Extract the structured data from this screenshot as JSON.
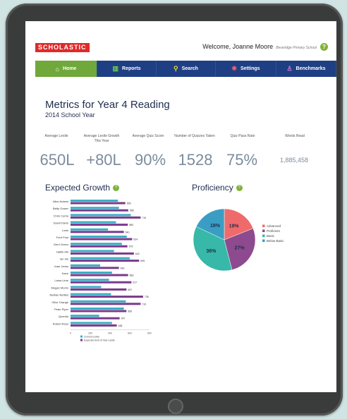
{
  "header": {
    "logo_text": "SCHOLASTIC",
    "welcome": "Welcome, Joanne Moore",
    "school": "Beveridge Primary School",
    "help_icon": "?"
  },
  "nav": {
    "tabs": [
      {
        "label": "Home",
        "icon": "home-icon",
        "active": true
      },
      {
        "label": "Reports",
        "icon": "bar-chart-icon",
        "active": false
      },
      {
        "label": "Search",
        "icon": "search-icon",
        "active": false
      },
      {
        "label": "Settings",
        "icon": "gear-icon",
        "active": false
      },
      {
        "label": "Benchmarks",
        "icon": "person-icon",
        "active": false
      }
    ]
  },
  "page": {
    "title": "Metrics for Year 4 Reading",
    "subtitle": "2014 School Year"
  },
  "metrics": [
    {
      "label": "Average Lexile",
      "value": "650L"
    },
    {
      "label": "Average Lexile Growth This Year",
      "value": "+80L"
    },
    {
      "label": "Average Quiz Score",
      "value": "90%"
    },
    {
      "label": "Number of Quizzes Taken",
      "value": "1528"
    },
    {
      "label": "Quiz Pass Rate",
      "value": "75%"
    },
    {
      "label": "Words Read",
      "value": "1,885,458"
    }
  ],
  "expected_growth": {
    "title": "Expected Growth",
    "info": "?"
  },
  "proficiency": {
    "title": "Proficiency",
    "info": "?"
  },
  "chart_data": [
    {
      "type": "bar",
      "orientation": "horizontal",
      "categories": [
        "Alice Adams",
        "Betty Gower",
        "Chris Currie",
        "David Davis",
        "Leah",
        "Fred Post",
        "Gerri Green",
        "Hattie Hill",
        "Ian Ink",
        "Joan Jones",
        "Kane",
        "Laina Lime",
        "Megan Morris",
        "Nathan Nettles",
        "Olive Orange",
        "Peter Piper",
        "Quentin",
        "Robert Ross"
      ],
      "series": [
        {
          "name": "Current Lexile",
          "color": "#3aaec4",
          "values": [
            480,
            490,
            610,
            460,
            380,
            570,
            520,
            440,
            600,
            300,
            420,
            390,
            310,
            410,
            560,
            540,
            290,
            420
          ]
        },
        {
          "name": "Expected End of Year Lexile",
          "color": "#7a3a8c",
          "values": [
            555,
            585,
            710,
            580,
            540,
            624,
            576,
            642,
            695,
            490,
            583,
            617,
            567,
            735,
            710,
            566,
            497,
            468
          ]
        }
      ],
      "data_labels": [
        "555",
        "585",
        "710",
        "580",
        "540",
        "624",
        "576",
        "642",
        "695",
        "490",
        "583",
        "617",
        "567",
        "735",
        "710",
        "566",
        "497",
        "468"
      ],
      "xlim": [
        0,
        800
      ],
      "xticks": [
        "0",
        "200",
        "400",
        "600",
        "800"
      ]
    },
    {
      "type": "pie",
      "labels": [
        "Advanced",
        "Proficient",
        "Basic",
        "Below Basic"
      ],
      "values": [
        19,
        27,
        36,
        18
      ],
      "colors": [
        "#ef6b6b",
        "#8e4a8e",
        "#37b8a8",
        "#3a9ec4"
      ],
      "value_labels": [
        "19%",
        "27%",
        "36%",
        "18%"
      ]
    }
  ],
  "tablet": {
    "home_button": "home-button"
  }
}
